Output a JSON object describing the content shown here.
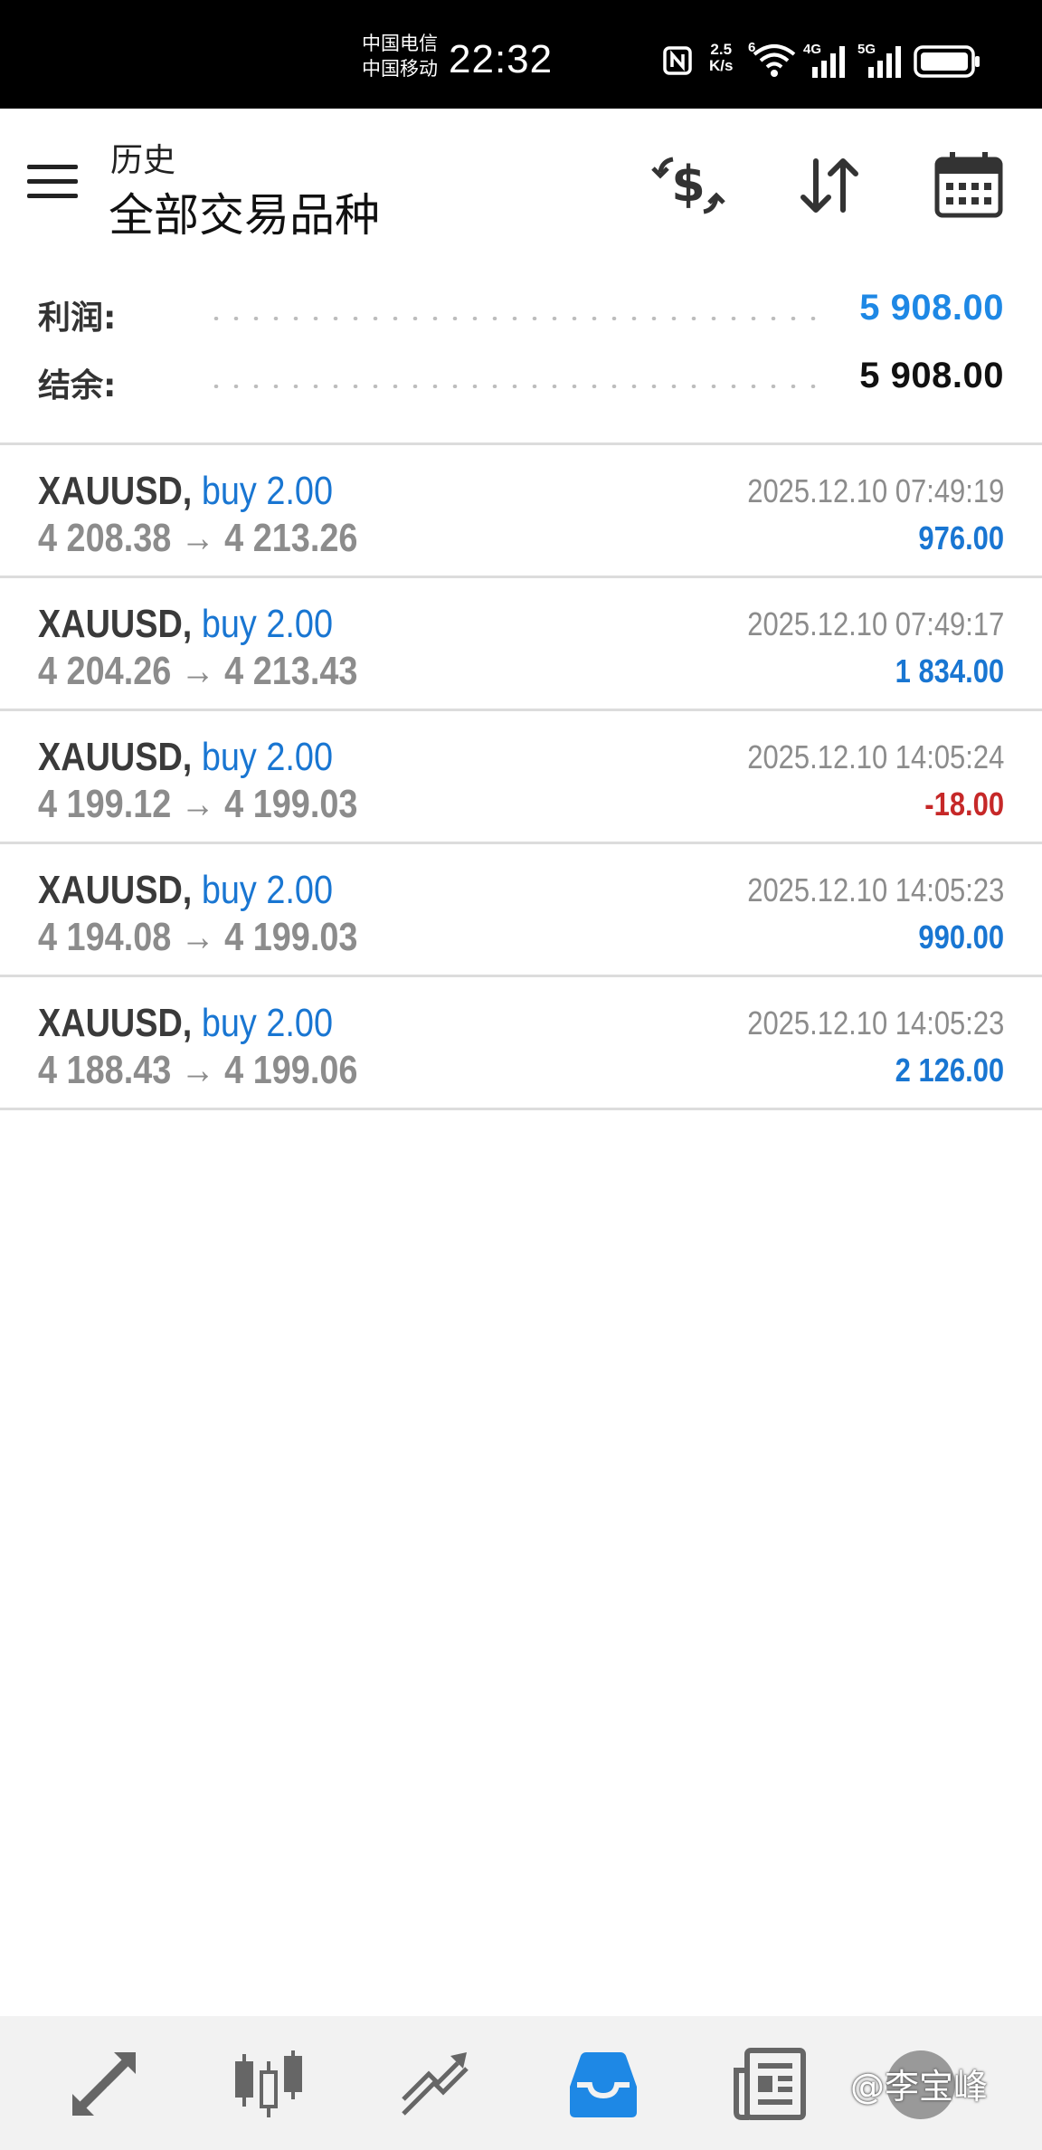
{
  "status_bar": {
    "carrier_1": "中国电信",
    "carrier_2": "中国移动",
    "time": "22:32",
    "net_speed_value": "2.5",
    "net_speed_unit": "K/s",
    "wifi_tag": "6",
    "sim1_tag": "4G",
    "sim2_tag": "5G",
    "icons": [
      "nfc-icon",
      "wifi-icon",
      "signal-icon",
      "signal-icon",
      "battery-icon"
    ]
  },
  "header": {
    "title": "历史",
    "subtitle": "全部交易品种",
    "icons": [
      "menu-icon",
      "dollar-exchange-icon",
      "sort-icon",
      "calendar-icon"
    ]
  },
  "summary": {
    "profit_label": "利润:",
    "profit_value": "5 908.00",
    "balance_label": "结余:",
    "balance_value": "5 908.00"
  },
  "colors": {
    "positive": "#1976d2",
    "negative": "#c62828",
    "accent": "#1e88e5",
    "muted": "#8c8c8c"
  },
  "trades": [
    {
      "symbol": "XAUUSD,",
      "action": "buy 2.00",
      "prices": "4 208.38 → 4 213.26",
      "time": "2025.12.10 07:49:19",
      "profit": "976.00",
      "negative": false
    },
    {
      "symbol": "XAUUSD,",
      "action": "buy 2.00",
      "prices": "4 204.26 → 4 213.43",
      "time": "2025.12.10 07:49:17",
      "profit": "1 834.00",
      "negative": false
    },
    {
      "symbol": "XAUUSD,",
      "action": "buy 2.00",
      "prices": "4 199.12 → 4 199.03",
      "time": "2025.12.10 14:05:24",
      "profit": "-18.00",
      "negative": true
    },
    {
      "symbol": "XAUUSD,",
      "action": "buy 2.00",
      "prices": "4 194.08 → 4 199.03",
      "time": "2025.12.10 14:05:23",
      "profit": "990.00",
      "negative": false
    },
    {
      "symbol": "XAUUSD,",
      "action": "buy 2.00",
      "prices": "4 188.43 → 4 199.06",
      "time": "2025.12.10 14:05:23",
      "profit": "2 126.00",
      "negative": false
    }
  ],
  "bottom_nav": {
    "items": [
      "quotes-icon",
      "chart-icon",
      "trade-icon",
      "history-icon",
      "news-icon",
      "settings-icon"
    ],
    "active": "history-icon"
  },
  "watermark": "@李宝峰"
}
